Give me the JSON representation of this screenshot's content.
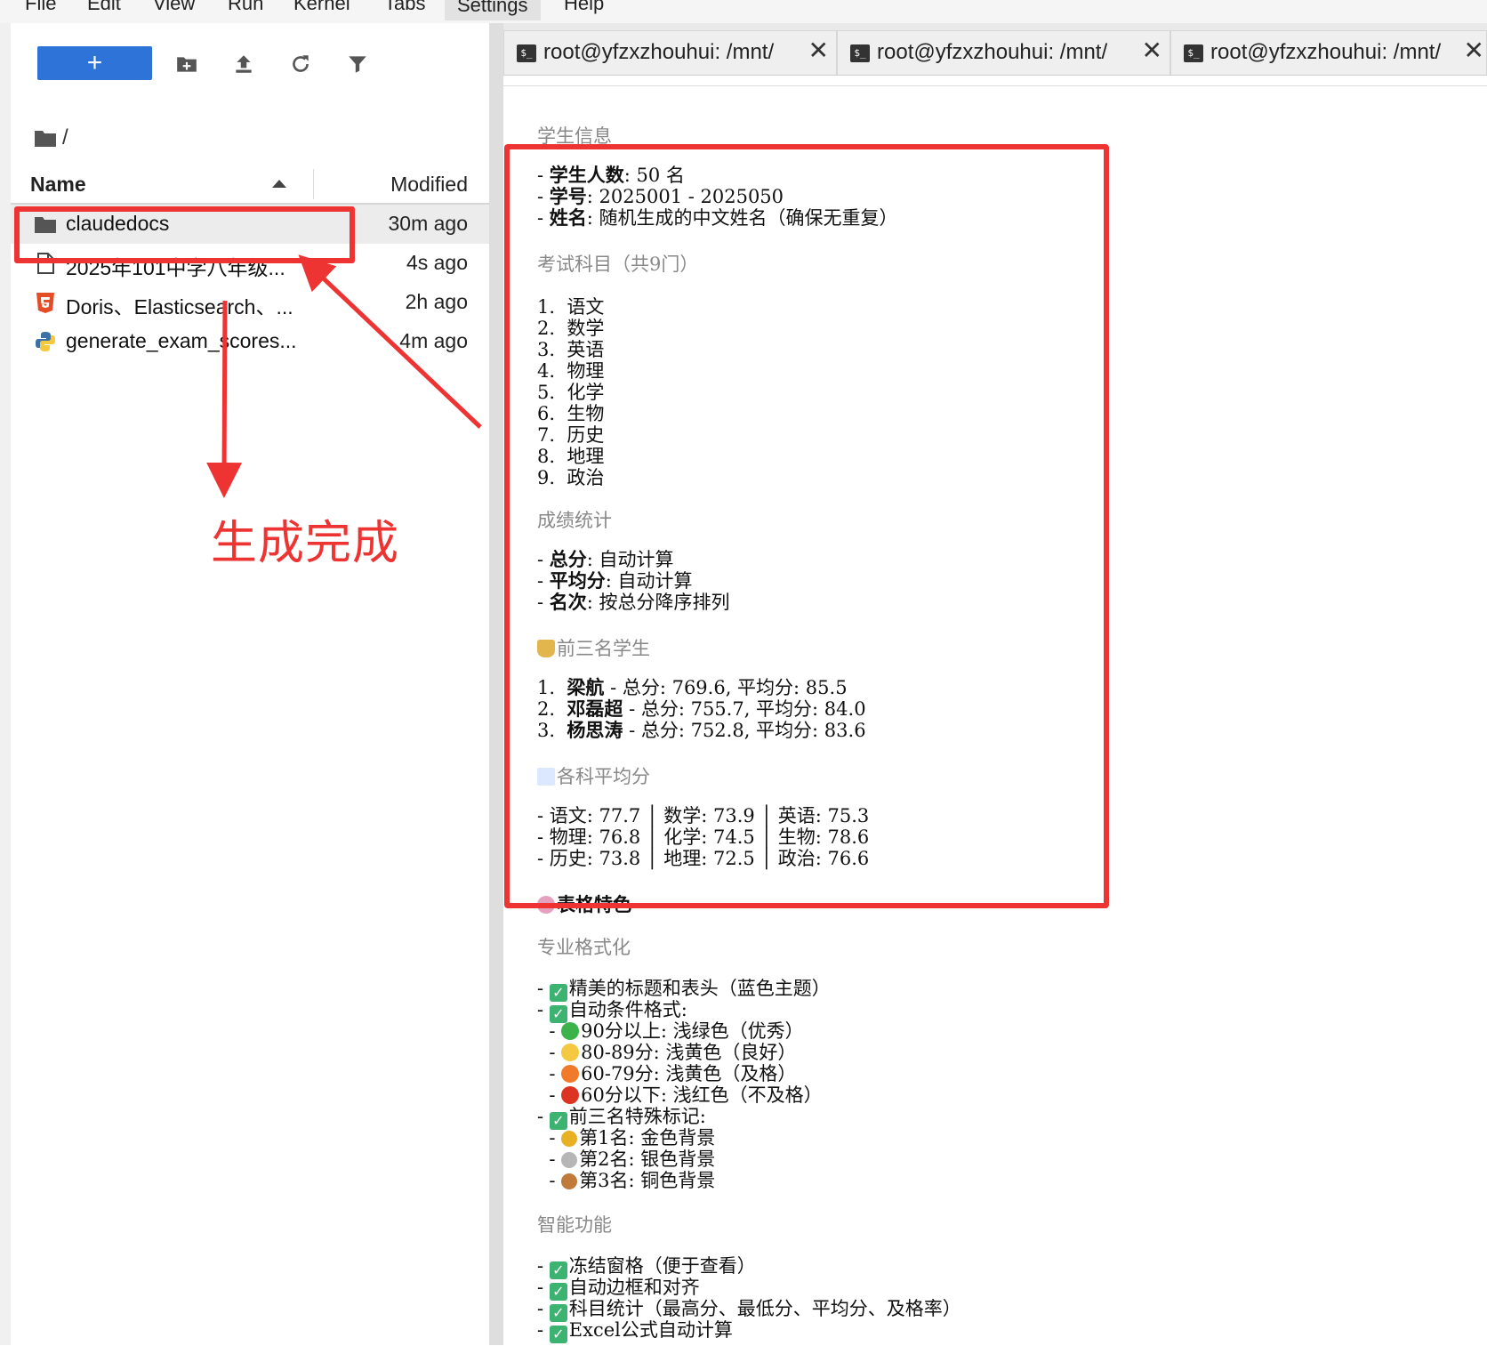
{
  "menu": [
    "File",
    "Edit",
    "View",
    "Run",
    "Kernel",
    "Tabs",
    "Settings",
    "Help"
  ],
  "toolbar": {
    "new_label": "+"
  },
  "breadcrumb": {
    "path": "/"
  },
  "file_list": {
    "col_name": "Name",
    "col_modified": "Modified",
    "rows": [
      {
        "name": "claudedocs",
        "modified": "30m ago",
        "icon": "folder-icon"
      },
      {
        "name": "2025年101中学八年级...",
        "modified": "4s ago",
        "icon": "file-icon"
      },
      {
        "name": "Doris、Elasticsearch、...",
        "modified": "2h ago",
        "icon": "html-icon"
      },
      {
        "name": "generate_exam_scores...",
        "modified": "4m ago",
        "icon": "python-icon"
      }
    ]
  },
  "annotation": {
    "label": "生成完成",
    "color": "#ee3333"
  },
  "tabs": [
    {
      "label": "root@yfzxzhouhui: /mnt/"
    },
    {
      "label": "root@yfzxzhouhui: /mnt/"
    },
    {
      "label": "root@yfzxzhouhui: /mnt/"
    }
  ],
  "doc": {
    "h_students": "学生信息",
    "stu1_key": "学生人数",
    "stu1_val": ": 50 名",
    "stu2_key": "学号",
    "stu2_val": ": 2025001 - 2025050",
    "stu3_key": "姓名",
    "stu3_val": ": 随机生成的中文姓名（确保无重复）",
    "h_subjects": "考试科目（共9门）",
    "subjects": [
      "1.  语文",
      "2.  数学",
      "3.  英语",
      "4.  物理",
      "5.  化学",
      "6.  生物",
      "7.  历史",
      "8.  地理",
      "9.  政治"
    ],
    "h_stats": "成绩统计",
    "stat1_key": "总分",
    "stat1_val": ": 自动计算",
    "stat2_key": "平均分",
    "stat2_val": ": 自动计算",
    "stat3_key": "名次",
    "stat3_val": ": 按总分降序排列",
    "h_top3": "前三名学生",
    "top1_name": "梁航",
    "top1_val": " - 总分: 769.6, 平均分: 85.5",
    "top2_name": "邓磊超",
    "top2_val": " - 总分: 755.7, 平均分: 84.0",
    "top3_name": "杨思涛",
    "top3_val": " - 总分: 752.8, 平均分: 83.6",
    "h_avg": "各科平均分",
    "avg1": "- 语文: 77.7 │ 数学: 73.9 │ 英语: 75.3",
    "avg2": "- 物理: 76.8 │ 化学: 74.5 │ 生物: 78.6",
    "avg3": "- 历史: 73.8 │ 地理: 72.5 │ 政治: 76.6",
    "h_features": "表格特色",
    "h_format": "专业格式化",
    "fmt1": "精美的标题和表头（蓝色主题）",
    "fmt2": "自动条件格式:",
    "fmt2a": "90分以上: 浅绿色（优秀）",
    "fmt2b": "80-89分: 浅黄色（良好）",
    "fmt2c": "60-79分: 浅黄色（及格）",
    "fmt2d": "60分以下: 浅红色（不及格）",
    "fmt3": "前三名特殊标记:",
    "fmt3a": "第1名: 金色背景",
    "fmt3b": "第2名: 银色背景",
    "fmt3c": "第3名: 铜色背景",
    "h_smart": "智能功能",
    "smart1": "冻结窗格（便于查看）",
    "smart2": "自动边框和对齐",
    "smart3": "科目统计（最高分、最低分、平均分、及格率）",
    "smart4": "Excel公式自动计算"
  }
}
